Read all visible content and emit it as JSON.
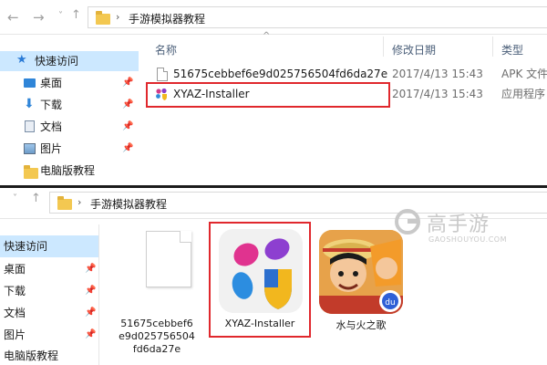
{
  "top": {
    "path": "手游模拟器教程",
    "sidebar": [
      {
        "label": "快速访问",
        "pinned": false,
        "icon": "star-icon"
      },
      {
        "label": "桌面",
        "pinned": true,
        "icon": "desktop-icon"
      },
      {
        "label": "下载",
        "pinned": true,
        "icon": "download-icon"
      },
      {
        "label": "文档",
        "pinned": true,
        "icon": "documents-icon"
      },
      {
        "label": "图片",
        "pinned": true,
        "icon": "pictures-icon"
      },
      {
        "label": "电脑版教程",
        "pinned": false,
        "icon": "folder-icon"
      }
    ],
    "columns": {
      "name": "名称",
      "date": "修改日期",
      "type": "类型"
    },
    "rows": [
      {
        "name": "51675cebbef6e9d025756504fd6da27e",
        "date": "2017/4/13 15:43",
        "type": "APK 文件"
      },
      {
        "name": "XYAZ-Installer",
        "date": "2017/4/13 15:43",
        "type": "应用程序"
      }
    ]
  },
  "bottom": {
    "path": "手游模拟器教程",
    "sidebar": [
      {
        "label": "快速访问",
        "pinned": false
      },
      {
        "label": "桌面",
        "pinned": true
      },
      {
        "label": "下载",
        "pinned": true
      },
      {
        "label": "文档",
        "pinned": true
      },
      {
        "label": "图片",
        "pinned": true
      },
      {
        "label": "电脑版教程",
        "pinned": false
      }
    ],
    "tiles": [
      {
        "label": "51675cebbef6e9d025756504fd6da27e"
      },
      {
        "label": "XYAZ-Installer"
      },
      {
        "label": "水与火之歌"
      }
    ]
  },
  "watermark": {
    "name": "高手游",
    "url": "GAOSHOUYOU.COM"
  },
  "colors": {
    "highlight": "#e0282d",
    "selection": "#cce8ff",
    "folder": "#f3c851"
  }
}
